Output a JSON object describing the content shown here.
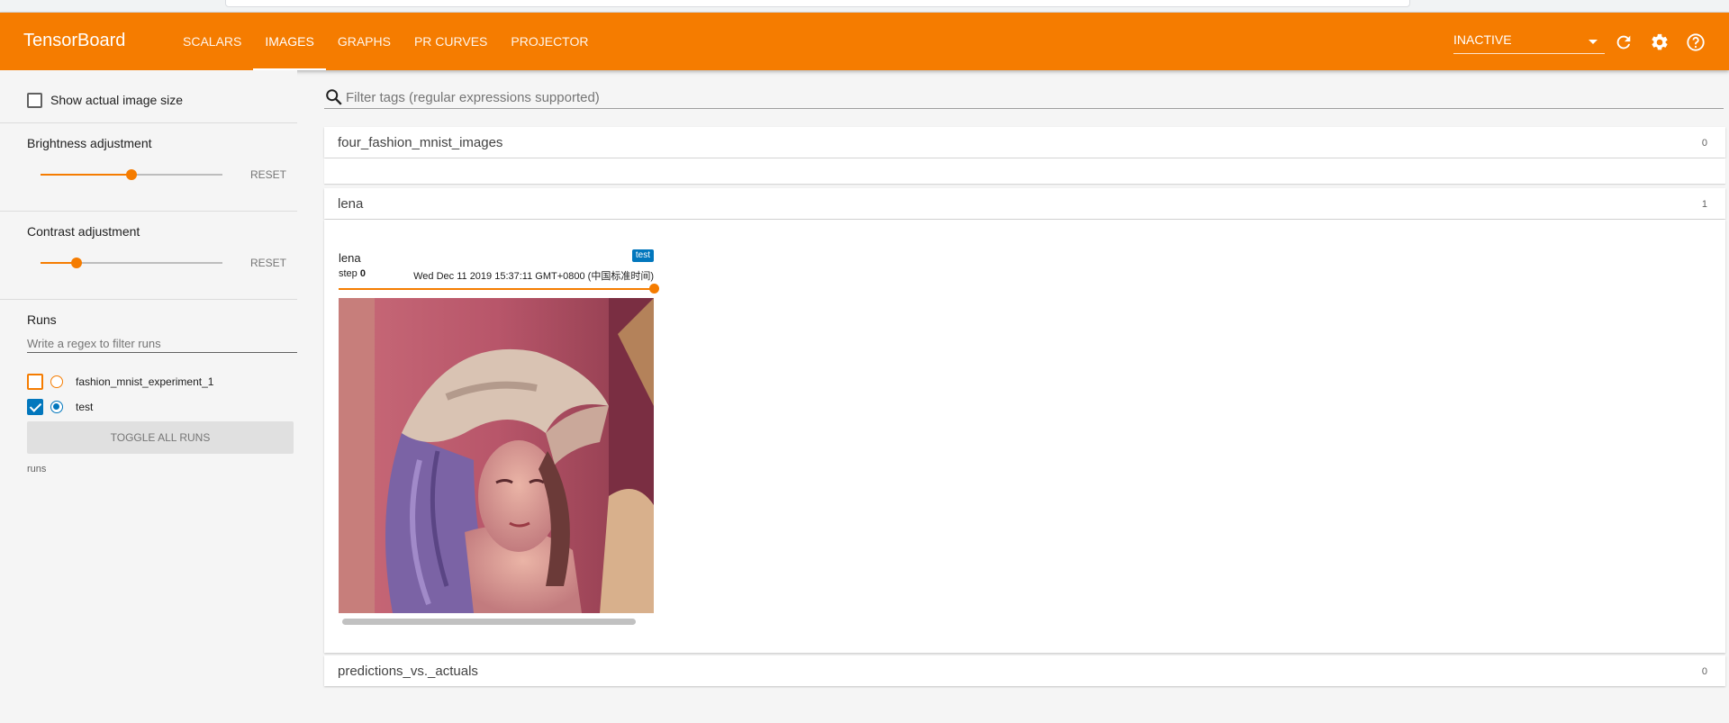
{
  "header": {
    "brand": "TensorBoard",
    "tabs": [
      {
        "label": "SCALARS",
        "active": false
      },
      {
        "label": "IMAGES",
        "active": true
      },
      {
        "label": "GRAPHS",
        "active": false
      },
      {
        "label": "PR CURVES",
        "active": false
      },
      {
        "label": "PROJECTOR",
        "active": false
      }
    ],
    "status_select": "INACTIVE",
    "icons": [
      "refresh-icon",
      "settings-icon",
      "help-icon"
    ],
    "accent_color": "#f57c00"
  },
  "sidebar": {
    "show_actual_size_label": "Show actual image size",
    "brightness": {
      "label": "Brightness adjustment",
      "reset": "RESET",
      "value": 0.5
    },
    "contrast": {
      "label": "Contrast adjustment",
      "reset": "RESET",
      "value": 0.2
    },
    "runs": {
      "title": "Runs",
      "filter_placeholder": "Write a regex to filter runs",
      "items": [
        {
          "name": "fashion_mnist_experiment_1",
          "checked": false,
          "color": "#f57c00"
        },
        {
          "name": "test",
          "checked": true,
          "color": "#0277bd"
        }
      ],
      "toggle_label": "TOGGLE ALL RUNS",
      "footer": "runs"
    }
  },
  "main": {
    "search_placeholder": "Filter tags (regular expressions supported)",
    "categories": [
      {
        "title": "four_fashion_mnist_images",
        "count": "0"
      },
      {
        "title": "lena",
        "count": "1"
      },
      {
        "title": "predictions_vs._actuals",
        "count": "0"
      }
    ],
    "image_card": {
      "title": "lena",
      "step_label": "step",
      "step_value": "0",
      "date": "Wed Dec 11 2019 15:37:11 GMT+0800 (中国标准时间)",
      "run_badge": "test"
    }
  }
}
